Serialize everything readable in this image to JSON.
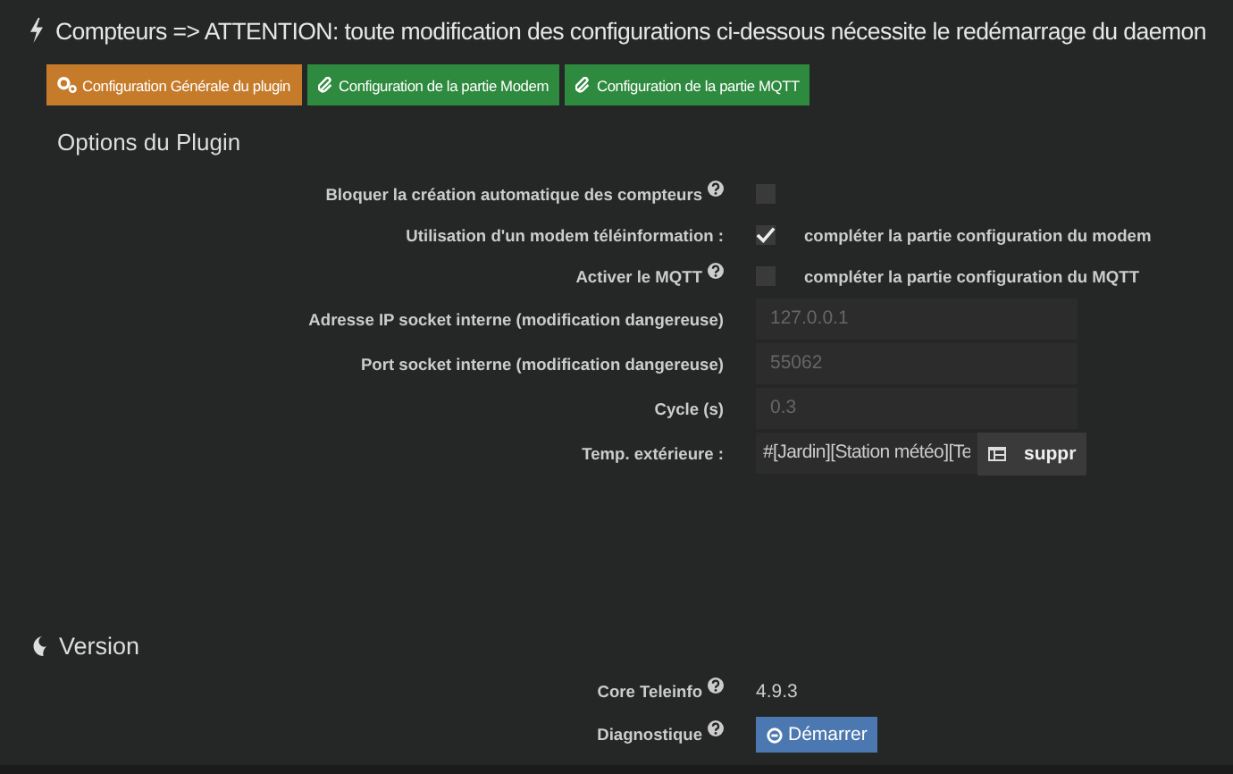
{
  "header": {
    "title": "Compteurs => ATTENTION: toute modification des configurations ci-dessous nécessite le redémarrage du daemon"
  },
  "tabs": [
    {
      "label": "Configuration Générale du plugin",
      "selected": true
    },
    {
      "label": "Configuration de la partie Modem",
      "selected": false
    },
    {
      "label": "Configuration de la partie MQTT",
      "selected": false
    }
  ],
  "options": {
    "title": "Options du Plugin",
    "rows": [
      {
        "kind": "checkbox",
        "label": "Bloquer la création automatique des compteurs",
        "help": true,
        "checked": false
      },
      {
        "kind": "checkbox",
        "label": "Utilisation d'un modem téléinformation :",
        "help": false,
        "checked": true,
        "note": "compléter la partie configuration du modem"
      },
      {
        "kind": "checkbox",
        "label": "Activer le MQTT",
        "help": true,
        "checked": false,
        "note": "compléter la partie configuration du MQTT"
      },
      {
        "kind": "input",
        "label": "Adresse IP socket interne (modification dangereuse)",
        "help": false,
        "placeholder": "127.0.0.1"
      },
      {
        "kind": "input",
        "label": "Port socket interne (modification dangereuse)",
        "help": false,
        "placeholder": "55062"
      },
      {
        "kind": "input",
        "label": "Cycle (s)",
        "help": false,
        "placeholder": "0.3"
      },
      {
        "kind": "command",
        "label": "Temp. extérieure :",
        "help": false,
        "value": "#[Jardin][Station météo][Te",
        "button": "suppr"
      }
    ]
  },
  "version": {
    "title": "Version",
    "rows": [
      {
        "kind": "text",
        "label": "Core Teleinfo",
        "help": true,
        "value": "4.9.3"
      },
      {
        "kind": "button",
        "label": "Diagnostique",
        "help": true,
        "button": "Démarrer"
      }
    ]
  }
}
